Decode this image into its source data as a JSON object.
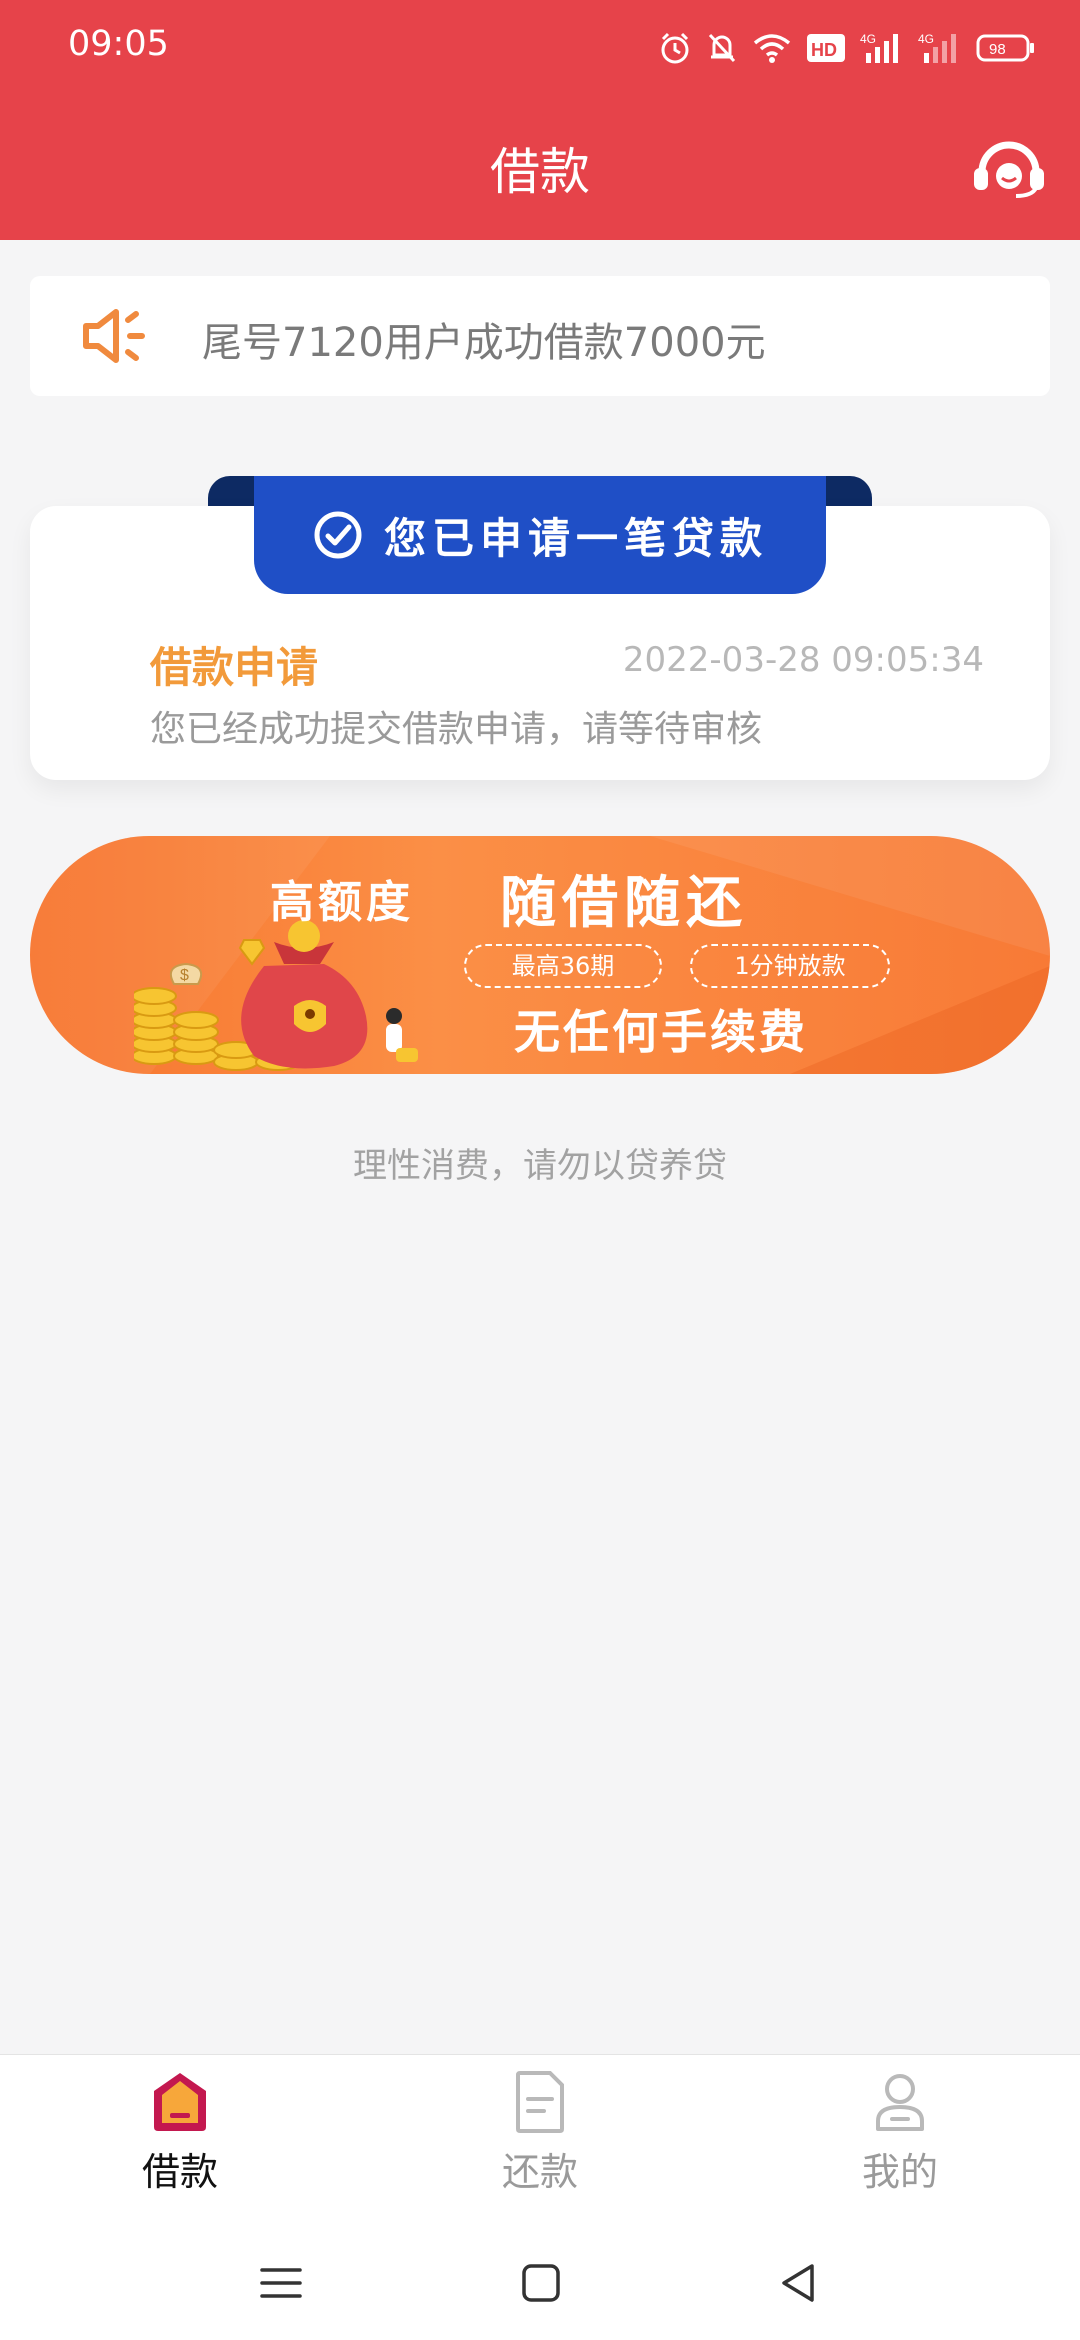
{
  "status": {
    "time": "09:05",
    "battery": "98",
    "network_left": "4G",
    "network_right": "4G",
    "hd": "HD"
  },
  "header": {
    "title": "借款"
  },
  "notice": {
    "text": "尾号7120用户成功借款7000元"
  },
  "loan_card": {
    "ribbon": "您已申请一笔贷款",
    "title": "借款申请",
    "time": "2022-03-28 09:05:34",
    "desc": "您已经成功提交借款申请，请等待审核"
  },
  "banner": {
    "headline_left": "高额度",
    "headline_right": "随借随还",
    "pill_1": "最高36期",
    "pill_2": "1分钟放款",
    "tagline": "无任何手续费"
  },
  "footer_note": "理性消费，请勿以贷养贷",
  "tabs": [
    {
      "label": "借款",
      "active": true
    },
    {
      "label": "还款",
      "active": false
    },
    {
      "label": "我的",
      "active": false
    }
  ],
  "colors": {
    "brand_red": "#e6434a",
    "accent_orange": "#f29a3a",
    "ribbon_blue": "#1f4fc6"
  }
}
